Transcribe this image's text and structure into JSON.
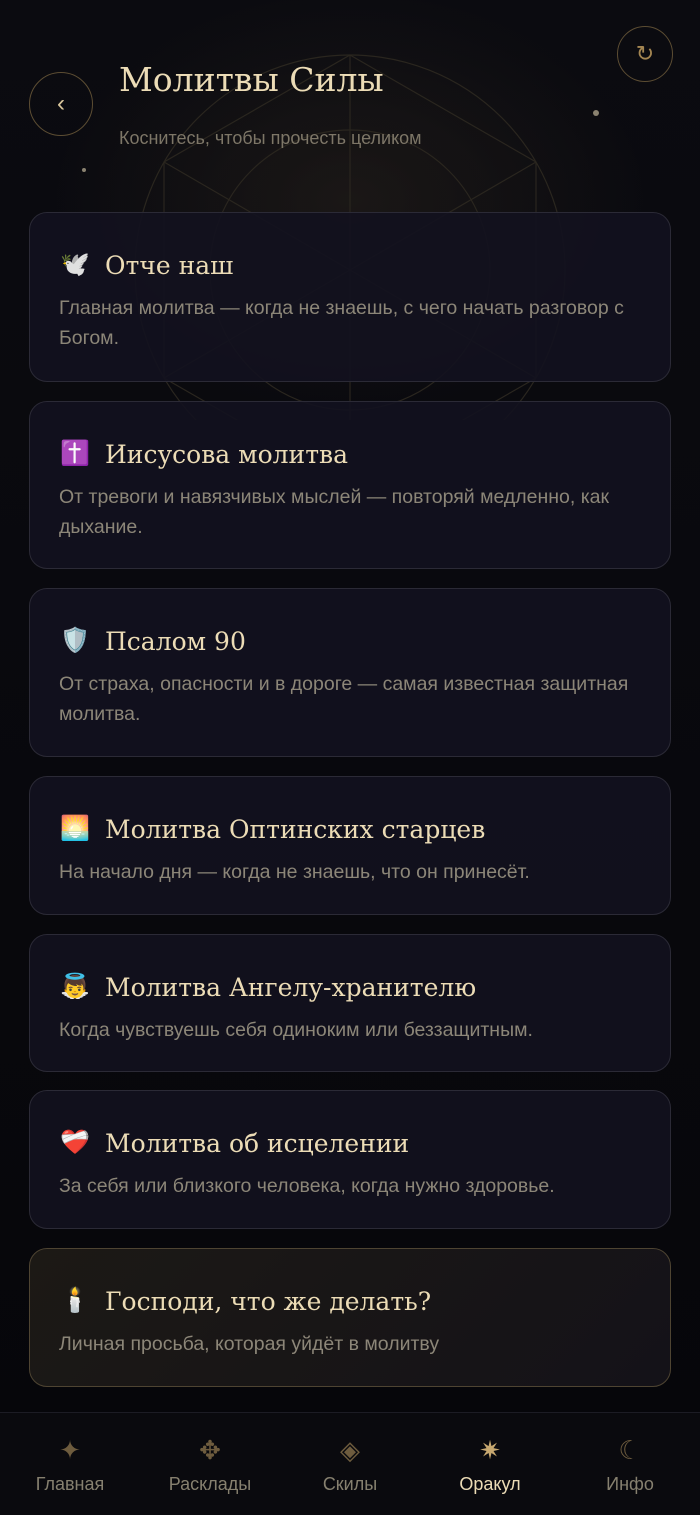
{
  "header": {
    "title": "Молитвы Силы",
    "subtitle": "Коснитесь, чтобы прочесть целиком",
    "back_icon": "‹",
    "refresh_icon": "↻"
  },
  "prayers": [
    {
      "icon": "🕊️",
      "icon_name": "dove-icon",
      "title": "Отче наш",
      "description": "Главная молитва — когда не знаешь, с чего начать разговор с Богом."
    },
    {
      "icon": "✝️",
      "icon_name": "cross-icon",
      "title": "Иисусова молитва",
      "description": "От тревоги и навязчивых мыслей — повторяй медленно, как дыхание."
    },
    {
      "icon": "🛡️",
      "icon_name": "shield-icon",
      "title": "Псалом 90",
      "description": "От страха, опасности и в дороге — самая известная защитная молитва."
    },
    {
      "icon": "🌅",
      "icon_name": "sunrise-icon",
      "title": "Молитва Оптинских старцев",
      "description": "На начало дня — когда не знаешь, что он принесёт."
    },
    {
      "icon": "👼",
      "icon_name": "angel-icon",
      "title": "Молитва Ангелу-хранителю",
      "description": "Когда чувствуешь себя одиноким или беззащитным."
    },
    {
      "icon": "❤️‍🩹",
      "icon_name": "mending-heart-icon",
      "title": "Молитва об исцелении",
      "description": "За себя или близкого человека, когда нужно здоровье."
    },
    {
      "icon": "🕯️",
      "icon_name": "candle-icon",
      "title": "Господи, что же делать?",
      "description": "Личная просьба, которая уйдёт в молитву"
    }
  ],
  "nav": {
    "items": [
      {
        "label": "Главная",
        "icon": "✦",
        "icon_name": "star-icon"
      },
      {
        "label": "Расклады",
        "icon": "✥",
        "icon_name": "cards-icon"
      },
      {
        "label": "Скилы",
        "icon": "◈",
        "icon_name": "diamond-icon"
      },
      {
        "label": "Оракул",
        "icon": "✷",
        "icon_name": "sparkle-icon",
        "active": true
      },
      {
        "label": "Инфо",
        "icon": "☾",
        "icon_name": "moon-icon"
      }
    ]
  },
  "colors": {
    "background": "#07070b",
    "card": "#12111e",
    "accent_gold": "#ecdcb6",
    "muted_text": "#8c8678",
    "border_gold": "#5c4d33"
  }
}
